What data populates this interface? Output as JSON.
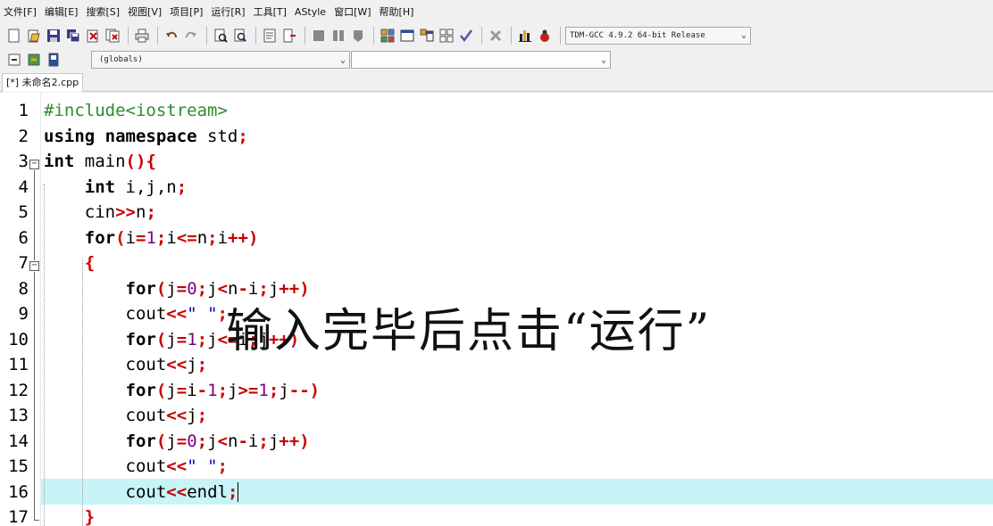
{
  "menu": [
    "文件[F]",
    "编辑[E]",
    "搜索[S]",
    "视图[V]",
    "项目[P]",
    "运行[R]",
    "工具[T]",
    "AStyle",
    "窗口[W]",
    "帮助[H]"
  ],
  "toolbar": {
    "compiler": "TDM-GCC 4.9.2 64-bit Release",
    "scope": "(globals)",
    "symbol": ""
  },
  "tab": {
    "label": "[*] 未命名2.cpp"
  },
  "editor": {
    "current_line": 16,
    "line_numbers": [
      "1",
      "2",
      "3",
      "4",
      "5",
      "6",
      "7",
      "8",
      "9",
      "10",
      "11",
      "12",
      "13",
      "14",
      "15",
      "16",
      "17"
    ],
    "lines": [
      "#include<iostream>",
      "using namespace std;",
      "int main(){",
      "    int i,j,n;",
      "    cin>>n;",
      "    for(i=1;i<=n;i++)",
      "    {",
      "        for(j=0;j<n-i;j++)",
      "        cout<<\" \";",
      "        for(j=1;j<=i;j++)",
      "        cout<<j;",
      "        for(j=i-1;j>=1;j--)",
      "        cout<<j;",
      "        for(j=0;j<n-i;j++)",
      "        cout<<\" \";",
      "        cout<<endl;",
      "    }"
    ]
  },
  "overlay_caption": "输入完毕后点击“运行”",
  "colors": {
    "keyword": "#000000",
    "symbol": "#c80000",
    "number": "#800080",
    "string": "#0000c8",
    "preprocessor": "#2e8b2e",
    "current_line": "#c8f3f7"
  }
}
